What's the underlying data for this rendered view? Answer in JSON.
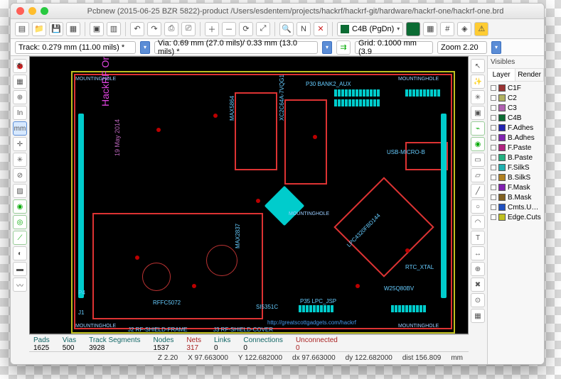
{
  "window": {
    "title": "Pcbnew (2015-06-25 BZR 5822)-product /Users/esdentem/projects/hackrf/hackrf-git/hardware/hackrf-one/hackrf-one.brd"
  },
  "toolbar": {
    "layer_selected": "C4B (PgDn)"
  },
  "options": {
    "track": "Track: 0.279 mm (11.00 mils) *",
    "via": "Via: 0.69 mm (27.0 mils)/ 0.33 mm (13.0 mils) *",
    "grid": "Grid: 0.1000 mm (3.9",
    "zoom": "Zoom 2.20"
  },
  "layers": {
    "header": "Visibles",
    "tab_layer": "Layer",
    "tab_render": "Render",
    "items": [
      {
        "name": "C1F",
        "color": "#993333"
      },
      {
        "name": "C2",
        "color": "#b0b060"
      },
      {
        "name": "C3",
        "color": "#b060b0"
      },
      {
        "name": "C4B",
        "color": "#0b6b33"
      },
      {
        "name": "F.Adhes",
        "color": "#2323b0"
      },
      {
        "name": "B.Adhes",
        "color": "#8023b0"
      },
      {
        "name": "F.Paste",
        "color": "#b02380"
      },
      {
        "name": "B.Paste",
        "color": "#23b080"
      },
      {
        "name": "F.SilkS",
        "color": "#20b0b0"
      },
      {
        "name": "B.SilkS",
        "color": "#b08020"
      },
      {
        "name": "F.Mask",
        "color": "#8020b0"
      },
      {
        "name": "B.Mask",
        "color": "#806020"
      },
      {
        "name": "Cmts.User",
        "color": "#2050c0"
      },
      {
        "name": "Edge.Cuts",
        "color": "#c0c020"
      }
    ]
  },
  "board_labels": {
    "title_top": "HackRF One",
    "date": "19 May 2014",
    "p30": "P30  BANK2_AUX",
    "usb": "USB-MICRO-B",
    "mainchip": "LPC4320FBD144",
    "sidechip": "XC2C64A-7VQG1",
    "side2": "MAX5864",
    "side3": "MAX2837",
    "rffc": "RFFC5072",
    "w25": "W25Q80BV",
    "si5351c": "SI5351C",
    "rtc": "RTC_XTAL",
    "p4": "P4",
    "j1": "J1",
    "p35": "P35  LPC_JSP",
    "shield_frame": "J2 RF-SHIELD-FRAME",
    "shield_cover": "J3 RF-SHIELD-COVER",
    "url": "http://greatscottgadgets.com/hackrf"
  },
  "stats": {
    "pads_l": "Pads",
    "pads_v": "1625",
    "vias_l": "Vias",
    "vias_v": "500",
    "trk_l": "Track Segments",
    "trk_v": "3928",
    "nodes_l": "Nodes",
    "nodes_v": "1537",
    "nets_l": "Nets",
    "nets_v": "317",
    "links_l": "Links",
    "links_v": "0",
    "conn_l": "Connections",
    "conn_v": "0",
    "unc_l": "Unconnected",
    "unc_v": "0"
  },
  "status": {
    "z": "Z 2.20",
    "x": "X 97.663000",
    "y": "Y 122.682000",
    "dx": "dx 97.663000",
    "dy": "dy 122.682000",
    "dist": "dist 156.809",
    "unit": "mm"
  }
}
